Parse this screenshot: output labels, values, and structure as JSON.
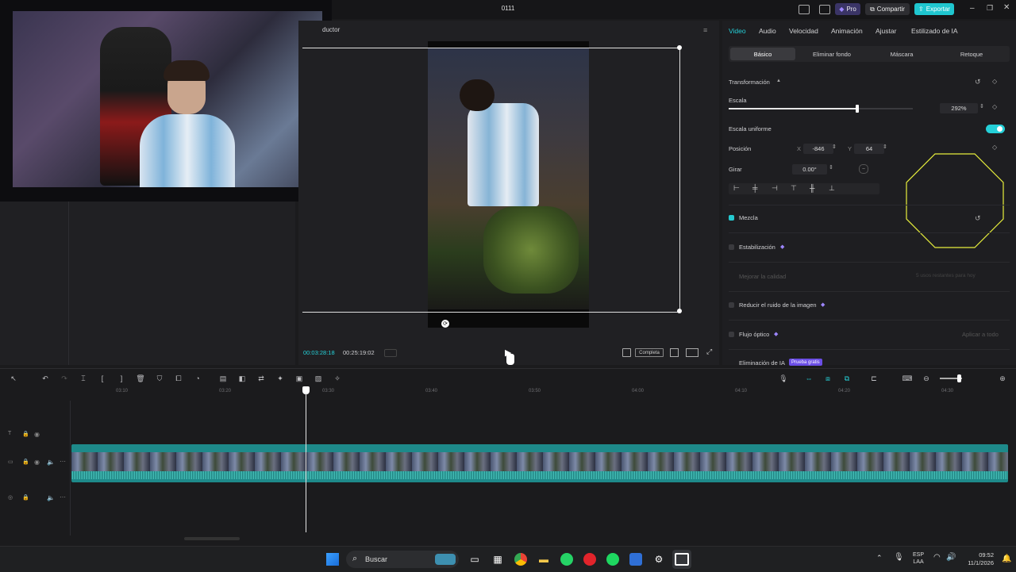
{
  "window": {
    "title": "0111"
  },
  "header": {
    "pro_label": "Pro",
    "share_label": "Compartir",
    "export_label": "Exportar"
  },
  "player": {
    "label": "ductor",
    "current_time": "00:03:28:18",
    "total_time": "00:25:19:02",
    "ratio_label": "Completa"
  },
  "props": {
    "tabs": [
      "Video",
      "Audio",
      "Velocidad",
      "Animación",
      "Ajustar",
      "Estilizado de IA"
    ],
    "subtabs": [
      "Básico",
      "Eliminar fondo",
      "Máscara",
      "Retoque"
    ],
    "transform_label": "Transformación",
    "scale_label": "Escala",
    "scale_value": "292%",
    "scale_fraction": 0.7,
    "uniform_label": "Escala uniforme",
    "position_label": "Posición",
    "pos_x_label": "X",
    "pos_x": "-846",
    "pos_y_label": "Y",
    "pos_y": "64",
    "rotate_label": "Girar",
    "rotate_value": "0.00°",
    "blend_label": "Mezcla",
    "stabilize_label": "Estabilización",
    "quality_label": "Mejorar la calidad",
    "quality_note": "5 usos restantes para hoy",
    "noise_label": "Reducir el ruido de la imagen",
    "flow_label": "Flujo óptico",
    "apply_all": "Aplicar a todo",
    "ai_remove_label": "Eliminación de IA",
    "ai_badge": "Prueba gratis"
  },
  "timeline": {
    "ruler": [
      "03:10",
      "03:20",
      "03:30",
      "03:40",
      "03:50",
      "04:00",
      "04:10",
      "04:20",
      "04:30"
    ]
  },
  "taskbar": {
    "search_placeholder": "Buscar",
    "lang_top": "ESP",
    "lang_bottom": "LAA",
    "time": "09:52",
    "date": "11/1/2026"
  },
  "colors": {
    "accent": "#25d0d8",
    "pro": "#7b5cf5",
    "track": "#1e8a8a"
  }
}
